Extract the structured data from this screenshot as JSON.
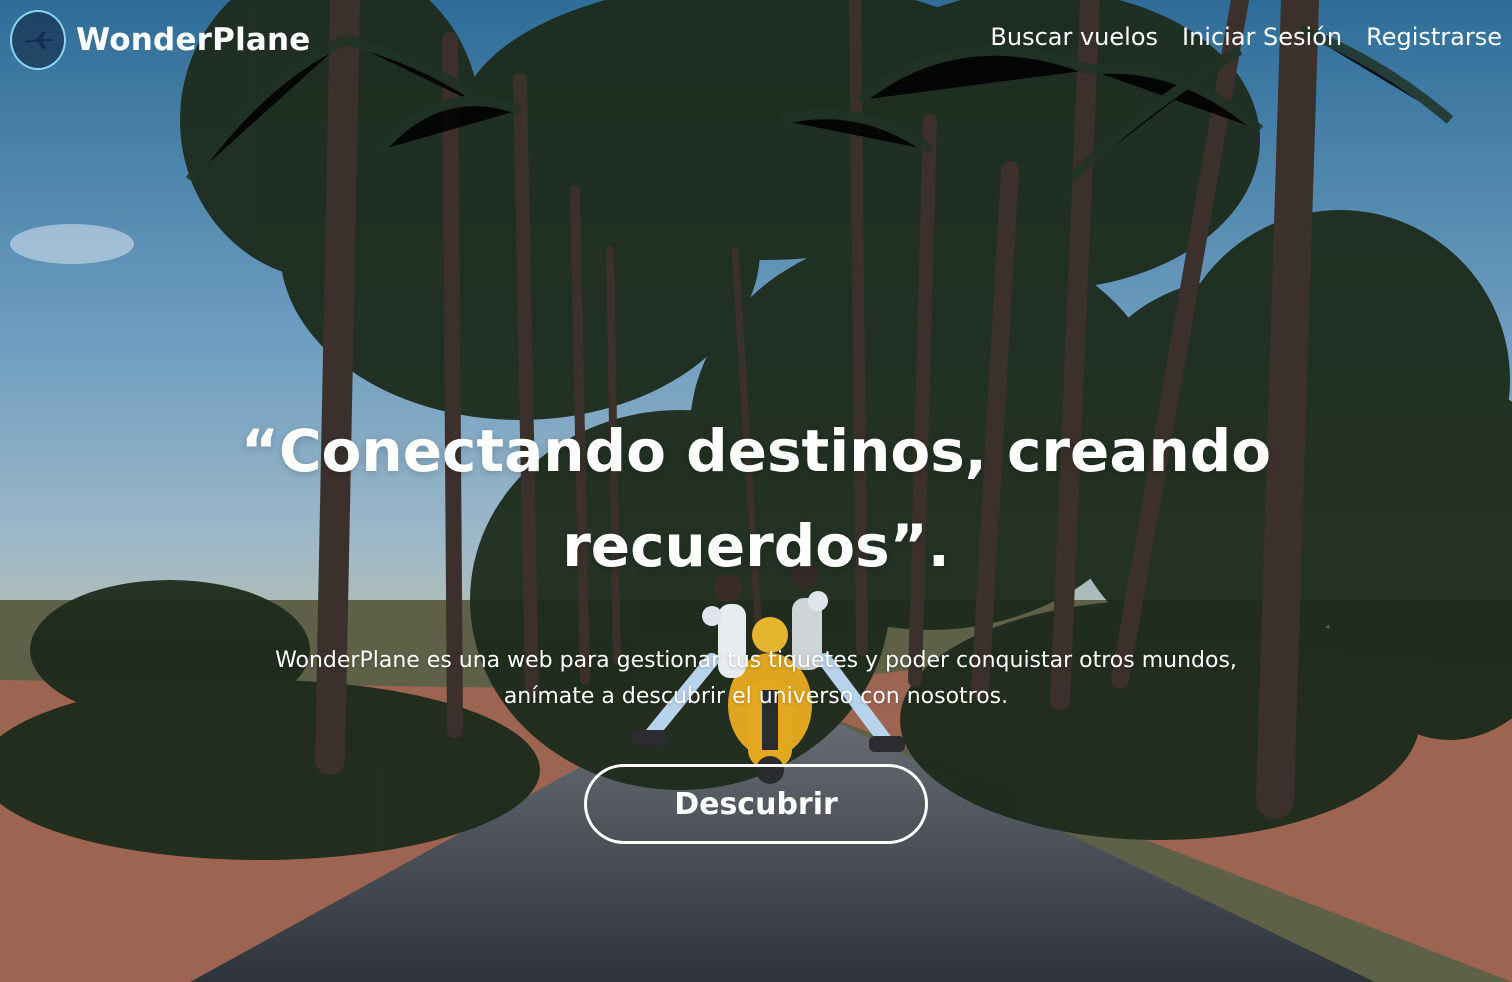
{
  "brand": {
    "name": "WonderPlane",
    "logo_icon": "airplane-icon"
  },
  "nav": {
    "links": [
      {
        "label": "Buscar vuelos"
      },
      {
        "label": "Iniciar Sesión"
      },
      {
        "label": "Registrarse"
      }
    ]
  },
  "hero": {
    "headline": "“Conectando destinos, creando recuerdos”.",
    "description": "WonderPlane es una web para gestionar tus tiquetes y poder conquistar otros mundos, anímate a descubrir el universo con nosotros.",
    "cta_label": "Descubrir"
  },
  "colors": {
    "text": "#ffffff",
    "logo_ring": "#8fd1f2",
    "sky": "#35719c",
    "road": "#3a3f45",
    "soil": "#a76b52",
    "scooter": "#e0a51f"
  }
}
